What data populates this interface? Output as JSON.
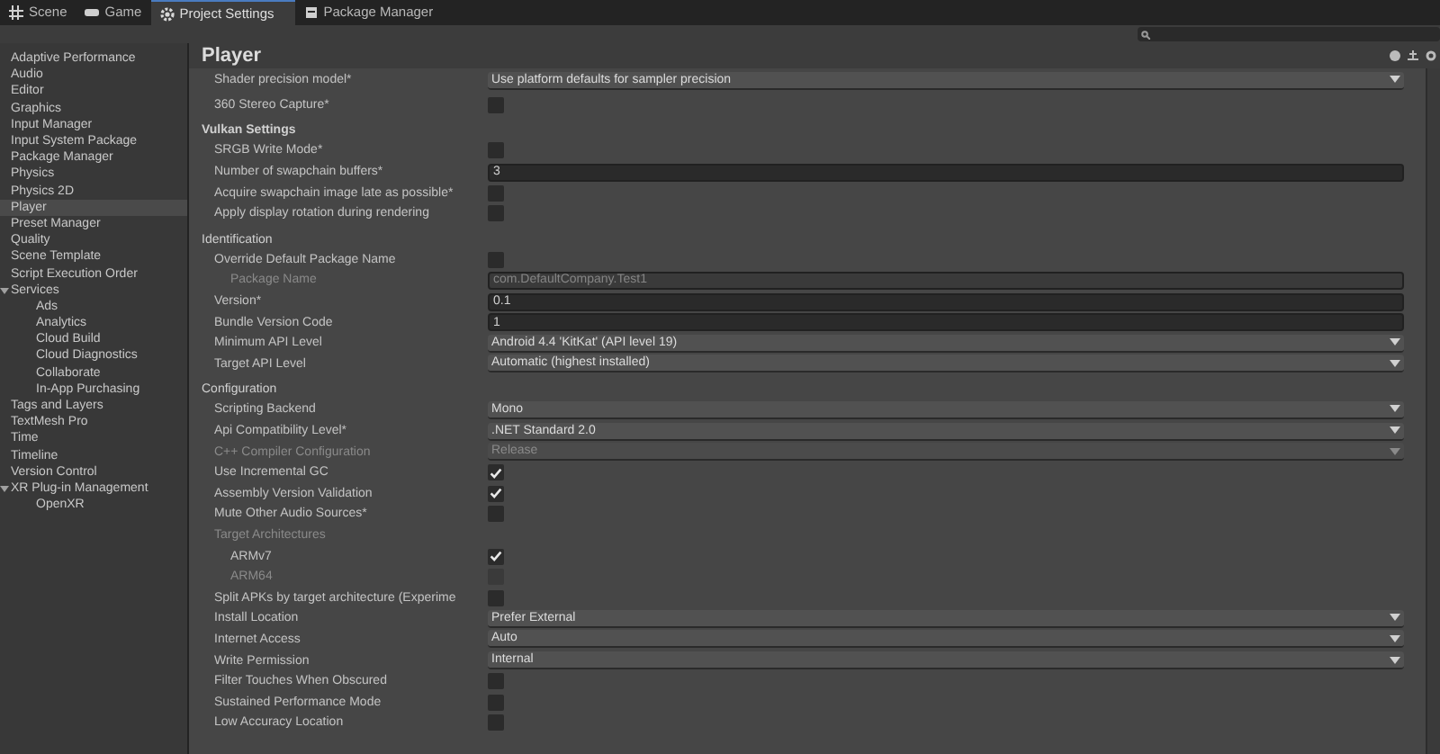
{
  "tabs": [
    {
      "label": "Scene",
      "selected": false
    },
    {
      "label": "Game",
      "selected": false
    },
    {
      "label": "Project Settings",
      "selected": true
    },
    {
      "label": "Package Manager",
      "selected": false
    }
  ],
  "sidebar": {
    "items": [
      {
        "label": "Adaptive Performance",
        "selected": false
      },
      {
        "label": "Audio",
        "selected": false
      },
      {
        "label": "Editor",
        "selected": false
      },
      {
        "label": "Graphics",
        "selected": false
      },
      {
        "label": "Input Manager",
        "selected": false
      },
      {
        "label": "Input System Package",
        "selected": false
      },
      {
        "label": "Package Manager",
        "selected": false
      },
      {
        "label": "Physics",
        "selected": false
      },
      {
        "label": "Physics 2D",
        "selected": false
      },
      {
        "label": "Player",
        "selected": true
      },
      {
        "label": "Preset Manager",
        "selected": false
      },
      {
        "label": "Quality",
        "selected": false
      },
      {
        "label": "Scene Template",
        "selected": false
      },
      {
        "label": "Script Execution Order",
        "selected": false
      },
      {
        "label": "Services",
        "selected": false,
        "expanded": true,
        "children": [
          {
            "label": "Ads",
            "selected": false
          },
          {
            "label": "Analytics",
            "selected": false
          },
          {
            "label": "Cloud Build",
            "selected": false
          },
          {
            "label": "Cloud Diagnostics",
            "selected": false
          },
          {
            "label": "Collaborate",
            "selected": false
          },
          {
            "label": "In-App Purchasing",
            "selected": false
          }
        ]
      },
      {
        "label": "Tags and Layers",
        "selected": false
      },
      {
        "label": "TextMesh Pro",
        "selected": false
      },
      {
        "label": "Time",
        "selected": false
      },
      {
        "label": "Timeline",
        "selected": false
      },
      {
        "label": "Version Control",
        "selected": false
      },
      {
        "label": "XR Plug-in Management",
        "selected": false,
        "expanded": true,
        "children": [
          {
            "label": "OpenXR",
            "selected": false
          }
        ]
      }
    ]
  },
  "panel": {
    "title": "Player",
    "sections": [
      {
        "rows": [
          {
            "kind": "dropdown",
            "label": "Shader precision model*",
            "value": "Use platform defaults for sampler precision",
            "disabled": false
          },
          {
            "kind": "checkbox",
            "label": "360 Stereo Capture*",
            "checked": false,
            "disabled": false
          }
        ]
      },
      {
        "title": "Vulkan Settings",
        "bold": true,
        "rows": [
          {
            "kind": "checkbox",
            "label": "SRGB Write Mode*",
            "checked": false,
            "disabled": false
          },
          {
            "kind": "field",
            "label": "Number of swapchain buffers*",
            "value": "3",
            "disabled": false
          },
          {
            "kind": "checkbox",
            "label": "Acquire swapchain image late as possible*",
            "checked": false,
            "disabled": false
          },
          {
            "kind": "checkbox",
            "label": "Apply display rotation during rendering",
            "checked": false,
            "disabled": false
          }
        ]
      },
      {
        "title": "Identification",
        "bold": false,
        "rows": [
          {
            "kind": "checkbox",
            "label": "Override Default Package Name",
            "checked": false,
            "disabled": false,
            "children": [
              {
                "kind": "field",
                "label": "Package Name",
                "value": "com.DefaultCompany.Test1",
                "disabled": true
              }
            ]
          },
          {
            "kind": "field",
            "label": "Version*",
            "value": "0.1",
            "disabled": false
          },
          {
            "kind": "field",
            "label": "Bundle Version Code",
            "value": "1",
            "disabled": false
          },
          {
            "kind": "dropdown",
            "label": "Minimum API Level",
            "value": "Android 4.4 'KitKat' (API level 19)",
            "disabled": false
          },
          {
            "kind": "dropdown",
            "label": "Target API Level",
            "value": "Automatic (highest installed)",
            "disabled": false
          }
        ]
      },
      {
        "title": "Configuration",
        "bold": false,
        "rows": [
          {
            "kind": "dropdown",
            "label": "Scripting Backend",
            "value": "Mono",
            "disabled": false
          },
          {
            "kind": "dropdown",
            "label": "Api Compatibility Level*",
            "value": ".NET Standard 2.0",
            "disabled": false
          },
          {
            "kind": "dropdown",
            "label": "C++ Compiler Configuration",
            "value": "Release",
            "disabled": true
          },
          {
            "kind": "checkbox",
            "label": "Use Incremental GC",
            "checked": true,
            "disabled": false
          },
          {
            "kind": "checkbox",
            "label": "Assembly Version Validation",
            "checked": true,
            "disabled": false
          },
          {
            "kind": "checkbox",
            "label": "Mute Other Audio Sources*",
            "checked": false,
            "disabled": false
          },
          {
            "kind": "label",
            "label": "Target Architectures",
            "disabled": true,
            "children": [
              {
                "kind": "checkbox",
                "label": "ARMv7",
                "checked": true,
                "disabled": false
              },
              {
                "kind": "checkbox",
                "label": "ARM64",
                "checked": false,
                "disabled": true
              }
            ]
          },
          {
            "kind": "checkbox",
            "label": "Split APKs by target architecture (Experime",
            "checked": false,
            "disabled": false
          },
          {
            "kind": "dropdown",
            "label": "Install Location",
            "value": "Prefer External",
            "disabled": false
          },
          {
            "kind": "dropdown",
            "label": "Internet Access",
            "value": "Auto",
            "disabled": false
          },
          {
            "kind": "dropdown",
            "label": "Write Permission",
            "value": "Internal",
            "disabled": false
          },
          {
            "kind": "checkbox",
            "label": "Filter Touches When Obscured",
            "checked": false,
            "disabled": false
          },
          {
            "kind": "checkbox",
            "label": "Sustained Performance Mode",
            "checked": false,
            "disabled": false
          },
          {
            "kind": "checkbox",
            "label": "Low Accuracy Location",
            "checked": false,
            "disabled": false
          }
        ]
      }
    ]
  }
}
